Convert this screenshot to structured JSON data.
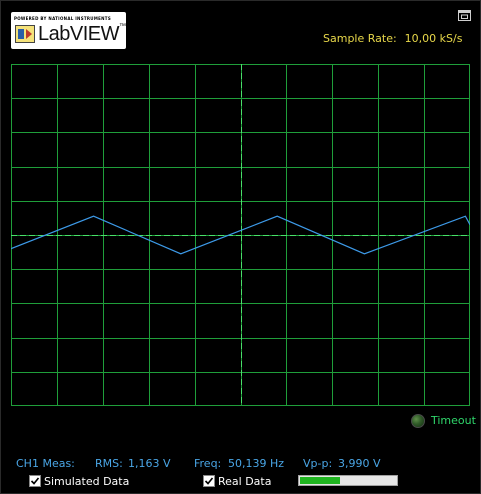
{
  "logo": {
    "brand_strip": "POWERED BY NATIONAL INSTRUMENTS",
    "name": "LabVIEW",
    "trademark": "™"
  },
  "header": {
    "sample_rate_label": "Sample Rate:",
    "sample_rate_value": "10,00 kS/s",
    "window_icon": "restore-window-icon"
  },
  "chart_data": {
    "type": "line",
    "grid": true,
    "divisions": {
      "x": 10,
      "y": 10
    },
    "series": [
      {
        "color": "#3d9ae8",
        "points": [
          [
            0.0,
            -0.4
          ],
          [
            1.8,
            0.55
          ],
          [
            3.7,
            -0.55
          ],
          [
            5.8,
            0.55
          ],
          [
            7.7,
            -0.55
          ],
          [
            9.9,
            0.55
          ],
          [
            10.0,
            0.3
          ]
        ]
      }
    ]
  },
  "status": {
    "timeout_label": "Timeout",
    "timeout_led": "off"
  },
  "measurements": {
    "channel_label": "CH1 Meas:",
    "rms_label": "RMS:",
    "rms_value": "1,163 V",
    "freq_label": "Freq:",
    "freq_value": "50,139 Hz",
    "vpp_label": "Vp-p:",
    "vpp_value": "3,990 V"
  },
  "controls": {
    "simulated_label": "Simulated Data",
    "simulated_checked": true,
    "real_label": "Real Data",
    "real_checked": true,
    "progress_fraction": 0.42
  },
  "colors": {
    "grid": "#1f9e3a",
    "center_axis": "#49e06a",
    "label_yellow": "#e8d84a",
    "label_blue": "#4aa6e6",
    "label_green": "#2fd66b"
  }
}
